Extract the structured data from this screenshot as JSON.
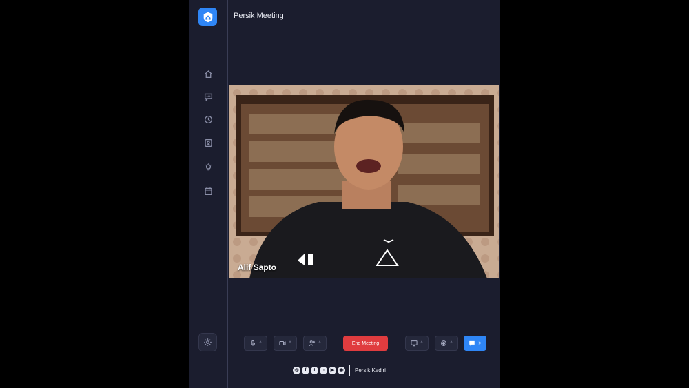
{
  "app": {
    "title": "Persik Meeting"
  },
  "sidebar": {
    "items": [
      {
        "name": "home",
        "icon": "home-icon"
      },
      {
        "name": "chat",
        "icon": "chat-bubble-icon"
      },
      {
        "name": "history",
        "icon": "clock-icon"
      },
      {
        "name": "contacts",
        "icon": "contact-card-icon"
      },
      {
        "name": "ideas",
        "icon": "lightbulb-icon"
      },
      {
        "name": "calendar",
        "icon": "calendar-icon"
      }
    ],
    "settings_icon": "gear-icon"
  },
  "participant": {
    "name": "Alif Sapto"
  },
  "controls": {
    "end_label": "End Meeting",
    "mic_icon": "microphone-icon",
    "camera_icon": "video-camera-icon",
    "participants_icon": "add-user-icon",
    "share_icon": "screen-share-icon",
    "record_icon": "record-icon",
    "chat_icon": "chat-icon"
  },
  "footer": {
    "social": [
      "instagram",
      "facebook",
      "twitter",
      "tiktok",
      "youtube",
      "website"
    ],
    "brand": "Persik Kediri"
  },
  "colors": {
    "background": "#1b1d2e",
    "accent": "#2f86f6",
    "end": "#e03c3f"
  }
}
